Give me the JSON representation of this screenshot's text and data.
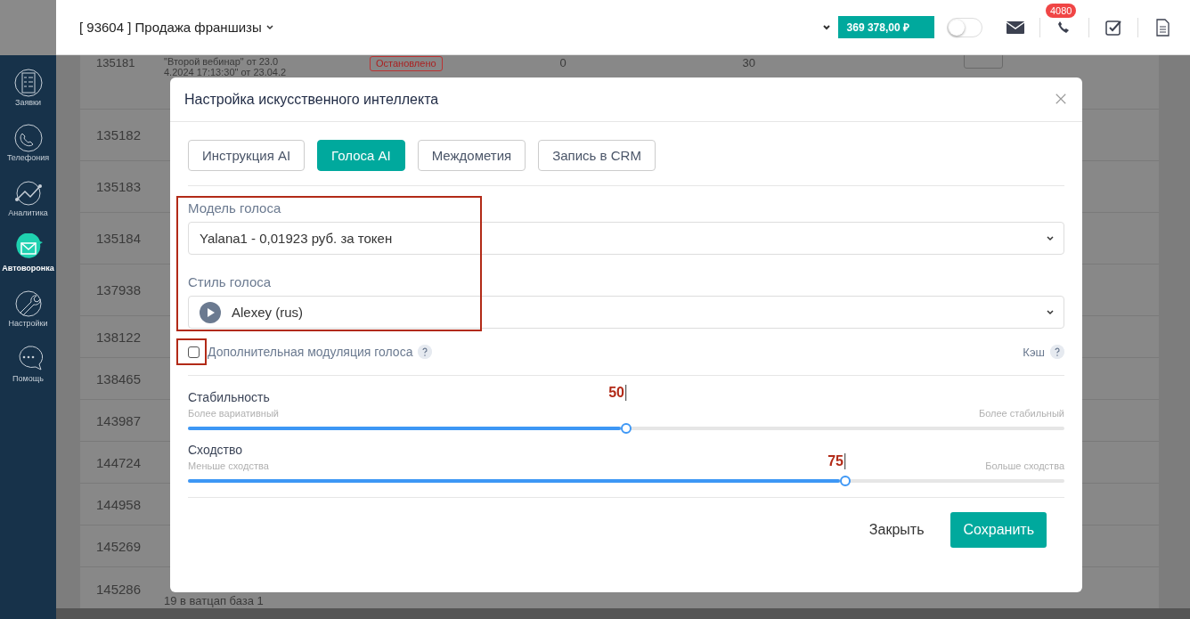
{
  "sidebar": {
    "items": [
      {
        "label": "Заявки",
        "selected": false
      },
      {
        "label": "Телефония",
        "selected": false
      },
      {
        "label": "Аналитика",
        "selected": false
      },
      {
        "label": "Автоворонка",
        "selected": true
      },
      {
        "label": "Настройки",
        "selected": false
      },
      {
        "label": "Помощь",
        "selected": false
      }
    ]
  },
  "header": {
    "project": "[ 93604 ] Продажа франшизы",
    "balance": "369 378,00 ₽",
    "toggle_on": false,
    "calls_badge": "4080"
  },
  "table": {
    "rows": [
      {
        "id": "135181",
        "text": [
          "\"Второй вебинар\" от 23.0",
          "4.2024 17:13:30\" от 23.04.2"
        ],
        "status": "Остановлено",
        "column_4": "0",
        "column_5": "30"
      },
      {
        "id": "135182"
      },
      {
        "id": "135183"
      },
      {
        "id": "135184"
      },
      {
        "id": "137938"
      },
      {
        "id": "138122"
      },
      {
        "id": "138465"
      },
      {
        "id": "143987"
      },
      {
        "id": "144724"
      },
      {
        "id": "144958"
      },
      {
        "id": "145269"
      },
      {
        "id": "145286",
        "text": [
          "19 в ватцап база 1"
        ]
      }
    ]
  },
  "modal": {
    "title": "Настройка искусственного интеллекта",
    "tabs": [
      {
        "label": "Инструкция AI",
        "selected": false
      },
      {
        "label": "Голоса AI",
        "selected": true
      },
      {
        "label": "Междометия",
        "selected": false
      },
      {
        "label": "Запись в CRM",
        "selected": false
      }
    ],
    "voice_model": {
      "label": "Модель голоса",
      "value": "Yalana1 - 0,01923 руб. за токен"
    },
    "voice_style": {
      "label": "Стиль голоса",
      "value": "Alexey (rus)"
    },
    "modulation": {
      "label": "Дополнительная модуляция голоса",
      "checked": false
    },
    "cache_label": "Кэш",
    "sliders": [
      {
        "label": "Стабильность",
        "min_label": "Более вариативный",
        "max_label": "Более стабильный",
        "value": "50",
        "level": 0.5
      },
      {
        "label": "Сходство",
        "min_label": "Меньше сходства",
        "max_label": "Больше сходства",
        "value": "75",
        "level": 0.75
      }
    ],
    "buttons": {
      "close": "Закрыть",
      "save": "Сохранить"
    }
  }
}
